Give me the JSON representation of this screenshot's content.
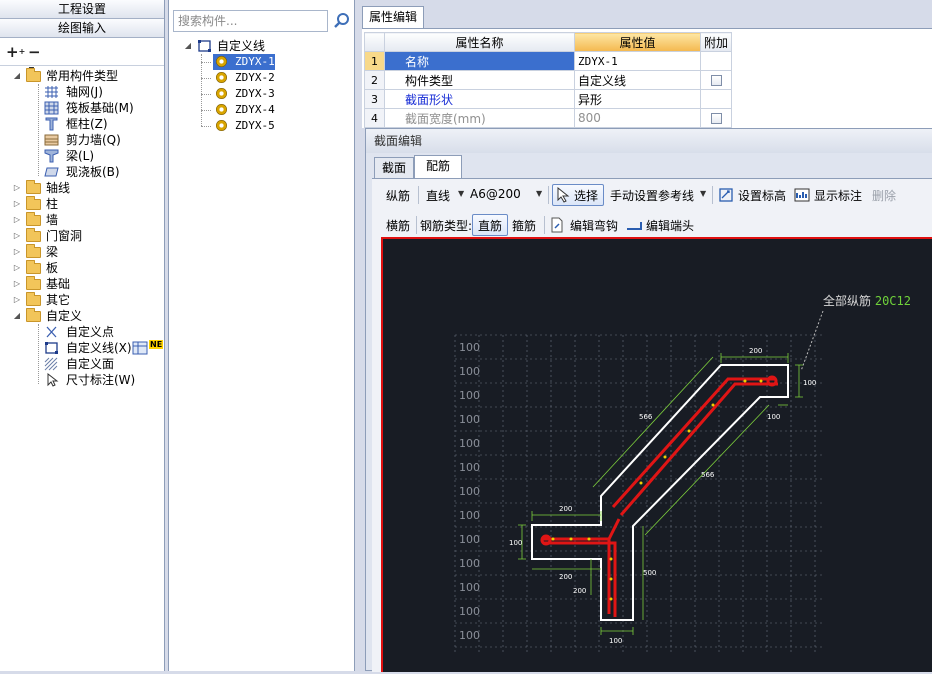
{
  "left_nav": {
    "top_button": "工程设置",
    "second_button": "绘图输入",
    "tree": {
      "common_group": "常用构件类型",
      "common_items": [
        "轴网(J)",
        "筏板基础(M)",
        "框柱(Z)",
        "剪力墙(Q)",
        "梁(L)",
        "现浇板(B)"
      ],
      "folders": [
        "轴线",
        "柱",
        "墙",
        "门窗洞",
        "梁",
        "板",
        "基础",
        "其它"
      ],
      "custom_group": "自定义",
      "custom_items": [
        "自定义点",
        "自定义线(X)",
        "自定义面",
        "尺寸标注(W)"
      ],
      "new_badge": "NE"
    }
  },
  "component_list": {
    "search_placeholder": "搜索构件...",
    "root": "自定义线",
    "items": [
      "ZDYX-1",
      "ZDYX-2",
      "ZDYX-3",
      "ZDYX-4",
      "ZDYX-5"
    ],
    "selected_index": 0
  },
  "properties": {
    "tab": "属性编辑",
    "headers": {
      "name": "属性名称",
      "value": "属性值",
      "extra": "附加"
    },
    "rows": [
      {
        "num": "1",
        "name": "名称",
        "value": "ZDYX-1"
      },
      {
        "num": "2",
        "name": "构件类型",
        "value": "自定义线"
      },
      {
        "num": "3",
        "name": "截面形状",
        "value": "异形"
      },
      {
        "num": "4",
        "name": "截面宽度(mm)",
        "value": "800"
      }
    ]
  },
  "section_editor": {
    "title": "截面编辑",
    "tabs": [
      "截面",
      "配筋"
    ],
    "active_tab": "配筋",
    "toolbar1": {
      "longitudinal": "纵筋",
      "line_mode": "直线",
      "rebar_spec": "A6@200",
      "select": "选择",
      "manual_ref": "手动设置参考线",
      "set_cover": "设置标高",
      "show_label": "显示标注",
      "delete": "删除"
    },
    "toolbar2": {
      "transverse": "横筋",
      "rebar_type_label": "钢筋类型:",
      "straight": "直筋",
      "stirrup": "箍筋",
      "edit_hook": "编辑弯钩",
      "edit_end": "编辑端头"
    },
    "drawing": {
      "annotation_label": "全部纵筋",
      "annotation_value": "20C12",
      "grid_label": "100",
      "dims": [
        "200",
        "100",
        "566",
        "100",
        "566",
        "200",
        "100",
        "200",
        "200",
        "500",
        "100"
      ],
      "colors": {
        "background": "#181c24",
        "outline": "#ffffff",
        "rebar": "#e01515",
        "dim": "#7dcf3c",
        "grid": "#8a8f99"
      }
    }
  }
}
